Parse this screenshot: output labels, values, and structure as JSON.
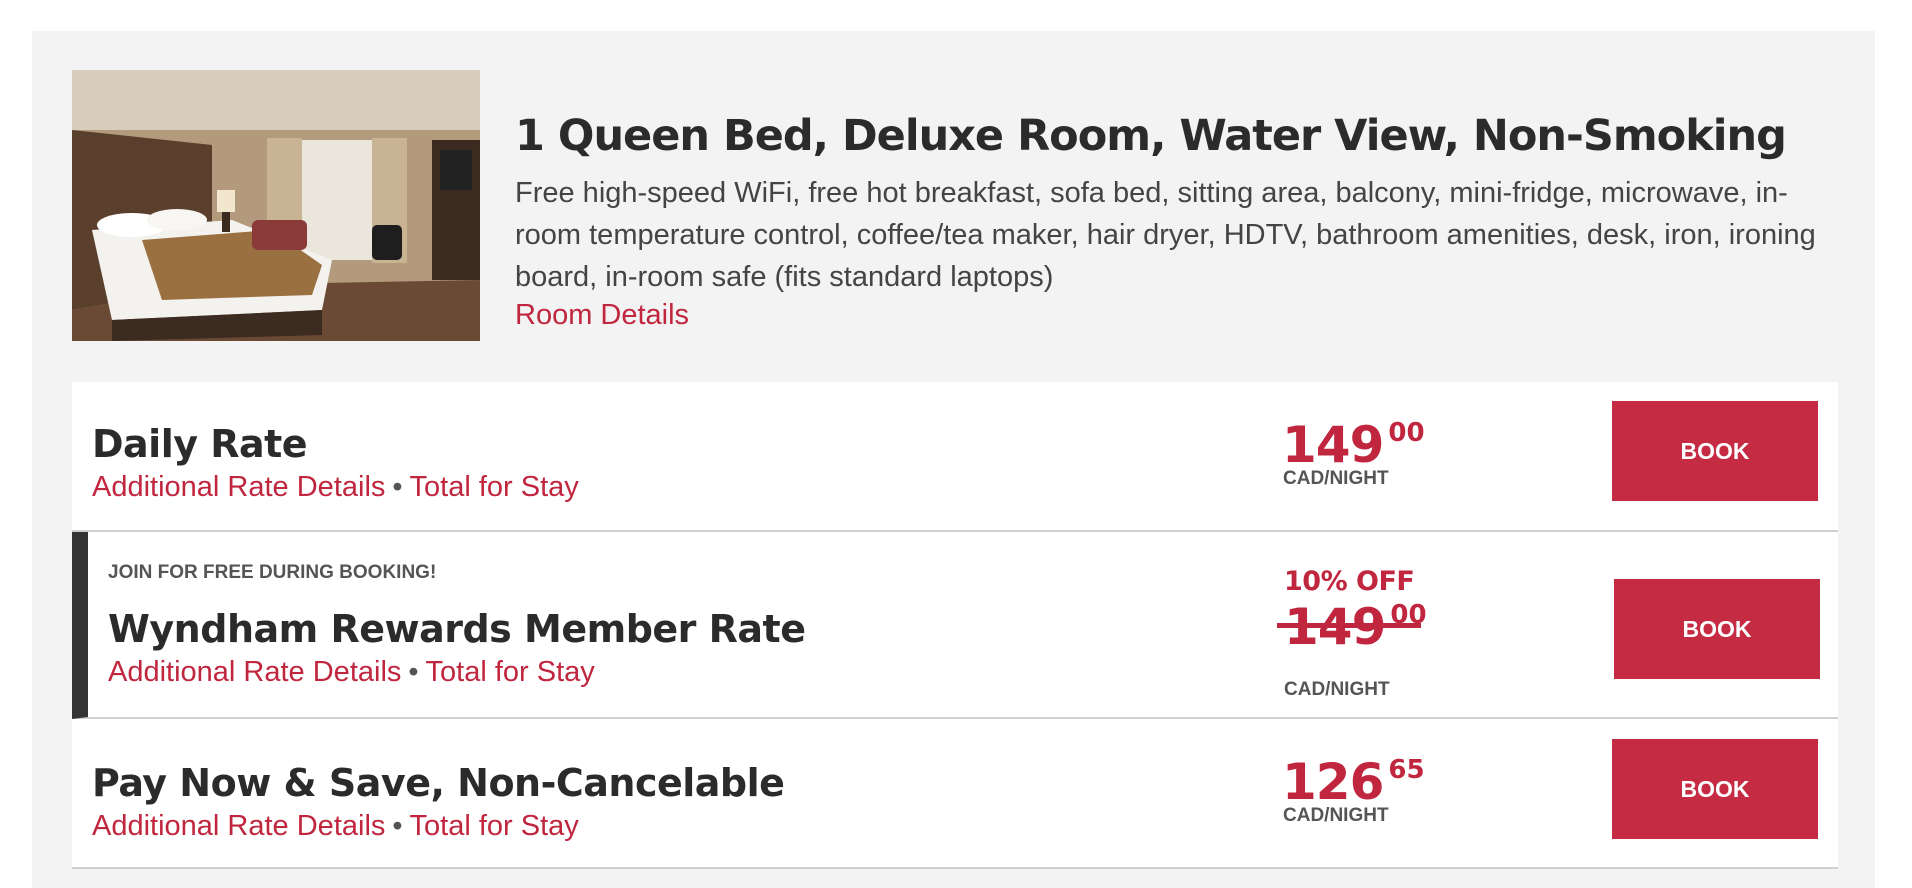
{
  "room": {
    "photo_alt": "Hotel room with queen bed",
    "title": "1 Queen Bed, Deluxe Room, Water View, Non-Smoking",
    "description": "Free high-speed WiFi, free hot breakfast, sofa bed, sitting area, balcony, mini-fridge, microwave, in-room temperature control, coffee/tea maker, hair dryer, HDTV, bathroom amenities, desk, iron, ironing board, in-room safe (fits standard laptops)",
    "details_link": "Room Details"
  },
  "rates": [
    {
      "name": "Daily Rate",
      "additional_details": "Additional Rate Details",
      "separator": "•",
      "total_for_stay": "Total for Stay",
      "price_whole": "149",
      "price_cents": "00",
      "price_unit": "CAD/NIGHT",
      "book_label": "BOOK"
    },
    {
      "promo": "JOIN FOR FREE DURING BOOKING!",
      "name": "Wyndham Rewards Member Rate",
      "additional_details": "Additional Rate Details",
      "separator": "•",
      "total_for_stay": "Total for Stay",
      "discount": "10% OFF",
      "price_whole": "149",
      "price_cents": "00",
      "price_struck": true,
      "price_unit": "CAD/NIGHT",
      "book_label": "BOOK"
    },
    {
      "name": "Pay Now & Save, Non-Cancelable",
      "additional_details": "Additional Rate Details",
      "separator": "•",
      "total_for_stay": "Total for Stay",
      "price_whole": "126",
      "price_cents": "65",
      "price_unit": "CAD/NIGHT",
      "book_label": "BOOK"
    }
  ],
  "colors": {
    "accent": "#c1263f",
    "button": "#c52b43",
    "panel_bg": "#f3f3f3",
    "member_bar": "#333333"
  }
}
